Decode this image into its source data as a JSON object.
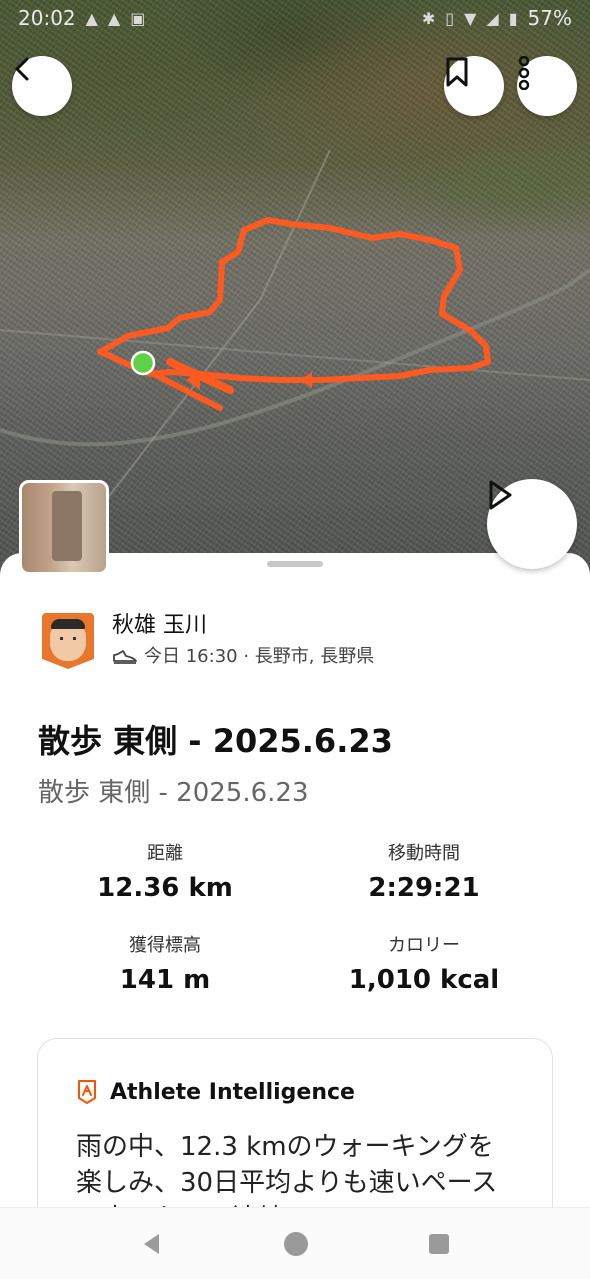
{
  "status_bar": {
    "time": "20:02",
    "battery": "57%"
  },
  "map": {
    "route_color": "#ff5a1f",
    "marker_color": "#5fd148"
  },
  "actions": {
    "back_icon": "chevron-left-icon",
    "bookmark_icon": "bookmark-icon",
    "more_icon": "more-vertical-icon",
    "play_icon": "play-icon"
  },
  "athlete": {
    "name": "秋雄 玉川",
    "activity_meta": "今日 16:30 · 長野市, 長野県"
  },
  "activity": {
    "title": "散歩 東側 - 2025.6.23",
    "description": "散歩 東側 - 2025.6.23"
  },
  "stats": [
    {
      "label": "距離",
      "value": "12.36 km"
    },
    {
      "label": "移動時間",
      "value": "2:29:21"
    },
    {
      "label": "獲得標高",
      "value": "141 m"
    },
    {
      "label": "カロリー",
      "value": "1,010 kcal"
    }
  ],
  "athlete_intelligence": {
    "title": "Athlete Intelligence",
    "text": "雨の中、12.3 kmのウォーキングを楽しみ、30日平均よりも速いペースで歩いた。二連続の"
  },
  "accent_color": "#fc5200"
}
